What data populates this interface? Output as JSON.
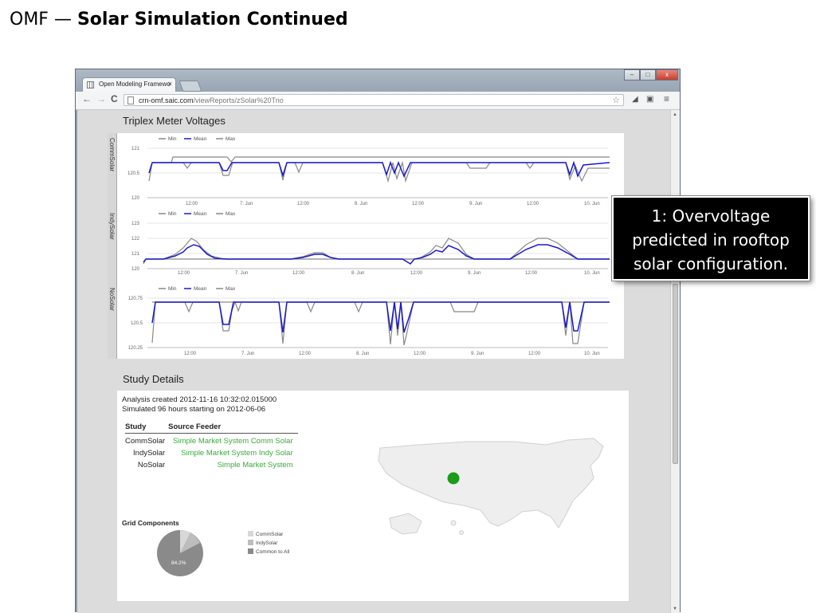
{
  "slide": {
    "prefix": "OMF —",
    "title": "Solar Simulation Continued"
  },
  "browser": {
    "tab_title": "Open Modeling Framewo",
    "tab_close": "×",
    "url_host": "crn-omf.saic.com",
    "url_path": "/viewReports/zSolar%20Trio",
    "nav": {
      "back": "←",
      "forward": "→",
      "reload": "C"
    },
    "window_buttons": {
      "minimize": "–",
      "maximize": "□",
      "close": "x"
    }
  },
  "voltages": {
    "title": "Triplex Meter Voltages",
    "legend": [
      "Min",
      "Mean",
      "Max"
    ],
    "colors": {
      "min": "#888888",
      "mean": "#1a1ac8",
      "max": "#888888"
    },
    "x_ticks": [
      "12:00",
      "7. Jun",
      "12:00",
      "8. Jun",
      "12:00",
      "9. Jun",
      "12:00",
      "10. Jun"
    ],
    "rows": [
      {
        "label": "CommSolar",
        "y_ticks": [
          "121",
          "120.5",
          "120"
        ]
      },
      {
        "label": "IndySolar",
        "y_ticks": [
          "123",
          "122",
          "121",
          "120"
        ]
      },
      {
        "label": "NoSolar",
        "y_ticks": [
          "120.75",
          "120.5",
          "120.25"
        ]
      }
    ]
  },
  "details": {
    "title": "Study Details",
    "created": "Analysis created 2012-11-16 10:32:02.015000",
    "simulated": "Simulated 96 hours starting on 2012-06-06",
    "headers": {
      "study": "Study",
      "feeder": "Source Feeder"
    },
    "rows": [
      {
        "study": "CommSolar",
        "feeder": "Simple Market System Comm Solar"
      },
      {
        "study": "IndySolar",
        "feeder": "Simple Market System Indy Solar"
      },
      {
        "study": "NoSolar",
        "feeder": "Simple Market System"
      }
    ],
    "grid_components": {
      "title": "Grid Components",
      "slice_label": "84.2%",
      "legend": [
        "CommSolar",
        "IndySolar",
        "Common to All"
      ]
    }
  },
  "callout": {
    "line1": "1: Overvoltage",
    "line2": "predicted in rooftop",
    "line3": "solar configuration."
  }
}
